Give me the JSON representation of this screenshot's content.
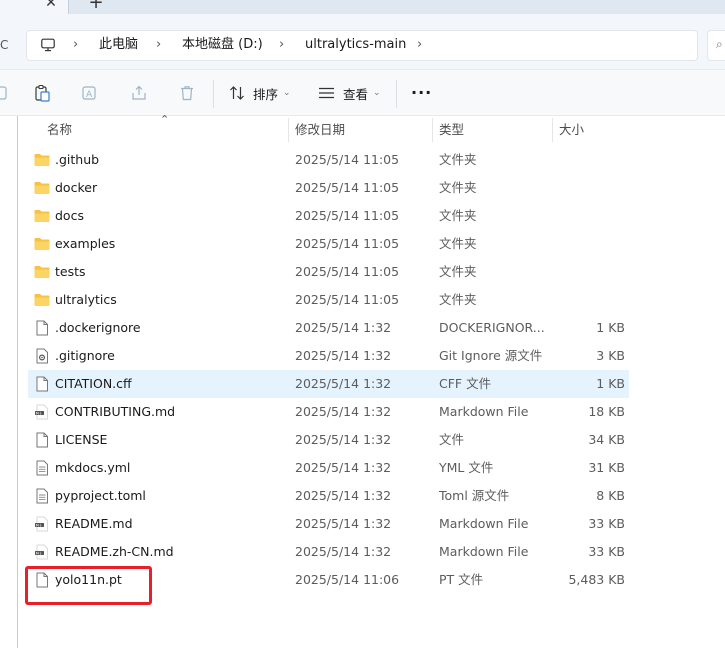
{
  "tabstrip": {
    "close_glyph": "✕",
    "new_tab_glyph": "+"
  },
  "address": {
    "left_edge_glyph": "C",
    "home_icon": "monitor-icon",
    "breadcrumbs": [
      "此电脑",
      "本地磁盘 (D:)",
      "ultralytics-main"
    ],
    "chevron_glyph": "›"
  },
  "commands": {
    "sort_label": "排序",
    "view_label": "查看",
    "more_label": "···",
    "icons": [
      "paste-icon",
      "rename-icon",
      "share-icon",
      "delete-icon"
    ]
  },
  "columns": {
    "name": "名称",
    "date": "修改日期",
    "type": "类型",
    "size": "大小"
  },
  "files": [
    {
      "name": ".github",
      "date": "2025/5/14 11:05",
      "type": "文件夹",
      "size": "",
      "icon": "folder-icon"
    },
    {
      "name": "docker",
      "date": "2025/5/14 11:05",
      "type": "文件夹",
      "size": "",
      "icon": "folder-icon"
    },
    {
      "name": "docs",
      "date": "2025/5/14 11:05",
      "type": "文件夹",
      "size": "",
      "icon": "folder-icon"
    },
    {
      "name": "examples",
      "date": "2025/5/14 11:05",
      "type": "文件夹",
      "size": "",
      "icon": "folder-icon"
    },
    {
      "name": "tests",
      "date": "2025/5/14 11:05",
      "type": "文件夹",
      "size": "",
      "icon": "folder-icon"
    },
    {
      "name": "ultralytics",
      "date": "2025/5/14 11:05",
      "type": "文件夹",
      "size": "",
      "icon": "folder-icon"
    },
    {
      "name": ".dockerignore",
      "date": "2025/5/14 1:32",
      "type": "DOCKERIGNOR...",
      "size": "1 KB",
      "icon": "file-icon"
    },
    {
      "name": ".gitignore",
      "date": "2025/5/14 1:32",
      "type": "Git Ignore 源文件",
      "size": "3 KB",
      "icon": "gear-file-icon"
    },
    {
      "name": "CITATION.cff",
      "date": "2025/5/14 1:32",
      "type": "CFF 文件",
      "size": "1 KB",
      "icon": "file-icon"
    },
    {
      "name": "CONTRIBUTING.md",
      "date": "2025/5/14 1:32",
      "type": "Markdown File",
      "size": "18 KB",
      "icon": "markdown-file-icon"
    },
    {
      "name": "LICENSE",
      "date": "2025/5/14 1:32",
      "type": "文件",
      "size": "34 KB",
      "icon": "file-icon"
    },
    {
      "name": "mkdocs.yml",
      "date": "2025/5/14 1:32",
      "type": "YML 文件",
      "size": "31 KB",
      "icon": "text-file-icon"
    },
    {
      "name": "pyproject.toml",
      "date": "2025/5/14 1:32",
      "type": "Toml 源文件",
      "size": "8 KB",
      "icon": "text-file-icon"
    },
    {
      "name": "README.md",
      "date": "2025/5/14 1:32",
      "type": "Markdown File",
      "size": "33 KB",
      "icon": "markdown-file-icon"
    },
    {
      "name": "README.zh-CN.md",
      "date": "2025/5/14 1:32",
      "type": "Markdown File",
      "size": "33 KB",
      "icon": "markdown-file-icon"
    },
    {
      "name": "yolo11n.pt",
      "date": "2025/5/14 11:06",
      "type": "PT 文件",
      "size": "5,483 KB",
      "icon": "file-icon"
    }
  ],
  "selected_file": "CITATION.cff",
  "highlighted_file": "yolo11n.pt",
  "colors": {
    "folder": "#f6c244",
    "selection": "#e5f3ff",
    "highlight_box": "#e8202a",
    "accent": "#0067c0"
  }
}
